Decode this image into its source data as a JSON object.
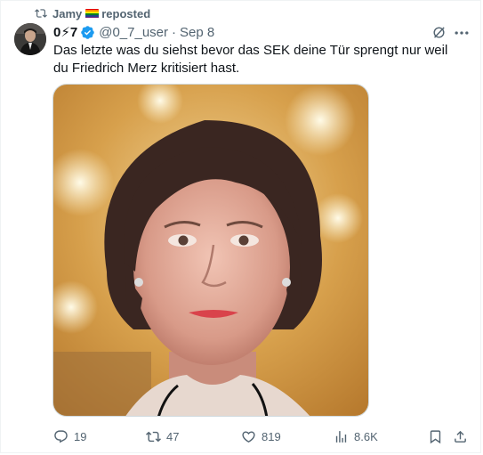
{
  "repost": {
    "user": "Jamy",
    "label": "reposted",
    "icon": "repost-icon"
  },
  "post": {
    "display_name": "0⚡7",
    "handle": "@0_7_user",
    "separator": "·",
    "date": "Sep 8",
    "verified": true,
    "text": "Das letzte was du siehst bevor das SEK deine Tür sprengt nur weil du Friedrich Merz kritisiert hast.",
    "image_description_icon": "portrait-photo"
  },
  "actions": {
    "replies": "19",
    "reposts": "47",
    "likes": "819",
    "views": "8.6K"
  },
  "colors": {
    "text": "#0f1419",
    "secondary": "#536471",
    "verified": "#1d9bf0",
    "border": "#cfd9de"
  }
}
